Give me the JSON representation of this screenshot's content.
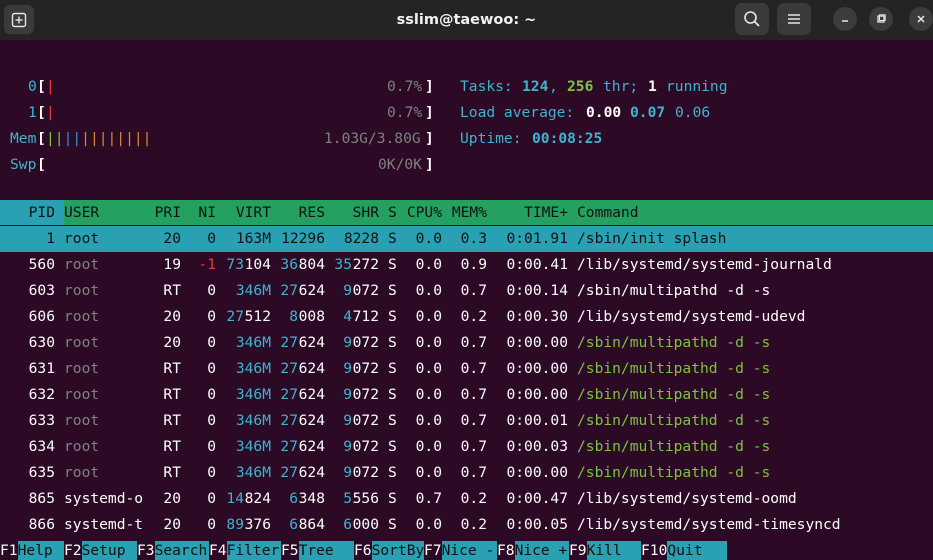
{
  "window": {
    "title": "sslim@taewoo: ~"
  },
  "icons": {
    "new_tab": "new-tab-icon",
    "search": "search-icon",
    "menu": "hamburger-menu-icon",
    "minimize": "minimize-icon",
    "maximize": "maximize-icon",
    "close": "close-icon"
  },
  "meters": {
    "cpu0": {
      "label": "0",
      "value": "0.7%",
      "fraction": 0.007
    },
    "cpu1": {
      "label": "1",
      "value": "0.7%",
      "fraction": 0.007
    },
    "mem": {
      "label": "Mem",
      "value": "1.03G/3.80G",
      "fraction": 0.27
    },
    "swp": {
      "label": "Swp",
      "value": "0K/0K",
      "fraction": 0.0
    }
  },
  "stats": {
    "tasks_label": "Tasks:",
    "tasks": "124",
    "threads": "256",
    "thr_label": "thr;",
    "running": "1",
    "running_label": "running",
    "load_label": "Load average:",
    "load1": "0.00",
    "load5": "0.07",
    "load15": "0.06",
    "uptime_label": "Uptime:",
    "uptime": "00:08:25"
  },
  "columns": [
    "PID",
    "USER",
    "PRI",
    "NI",
    "VIRT",
    "RES",
    "SHR",
    "S",
    "CPU%",
    "MEM%",
    "TIME+",
    "Command"
  ],
  "processes": [
    {
      "pid": "1",
      "user": "root",
      "pri": "20",
      "ni": "0",
      "virt": "163M",
      "res": "12296",
      "shr": "8228",
      "s": "S",
      "cpu": "0.0",
      "mem": "0.3",
      "time": "0:01.91",
      "cmd": "/sbin/init splash",
      "thread": false
    },
    {
      "pid": "560",
      "user": "root",
      "pri": "19",
      "ni": "-1",
      "virt": "73104",
      "res": "36804",
      "shr": "35272",
      "s": "S",
      "cpu": "0.0",
      "mem": "0.9",
      "time": "0:00.41",
      "cmd": "/lib/systemd/systemd-journald",
      "thread": false
    },
    {
      "pid": "603",
      "user": "root",
      "pri": "RT",
      "ni": "0",
      "virt": "346M",
      "res": "27624",
      "shr": "9072",
      "s": "S",
      "cpu": "0.0",
      "mem": "0.7",
      "time": "0:00.14",
      "cmd": "/sbin/multipathd -d -s",
      "thread": false
    },
    {
      "pid": "606",
      "user": "root",
      "pri": "20",
      "ni": "0",
      "virt": "27512",
      "res": "8008",
      "shr": "4712",
      "s": "S",
      "cpu": "0.0",
      "mem": "0.2",
      "time": "0:00.30",
      "cmd": "/lib/systemd/systemd-udevd",
      "thread": false
    },
    {
      "pid": "630",
      "user": "root",
      "pri": "20",
      "ni": "0",
      "virt": "346M",
      "res": "27624",
      "shr": "9072",
      "s": "S",
      "cpu": "0.0",
      "mem": "0.7",
      "time": "0:00.00",
      "cmd": "/sbin/multipathd -d -s",
      "thread": true
    },
    {
      "pid": "631",
      "user": "root",
      "pri": "RT",
      "ni": "0",
      "virt": "346M",
      "res": "27624",
      "shr": "9072",
      "s": "S",
      "cpu": "0.0",
      "mem": "0.7",
      "time": "0:00.00",
      "cmd": "/sbin/multipathd -d -s",
      "thread": true
    },
    {
      "pid": "632",
      "user": "root",
      "pri": "RT",
      "ni": "0",
      "virt": "346M",
      "res": "27624",
      "shr": "9072",
      "s": "S",
      "cpu": "0.0",
      "mem": "0.7",
      "time": "0:00.00",
      "cmd": "/sbin/multipathd -d -s",
      "thread": true
    },
    {
      "pid": "633",
      "user": "root",
      "pri": "RT",
      "ni": "0",
      "virt": "346M",
      "res": "27624",
      "shr": "9072",
      "s": "S",
      "cpu": "0.0",
      "mem": "0.7",
      "time": "0:00.01",
      "cmd": "/sbin/multipathd -d -s",
      "thread": true
    },
    {
      "pid": "634",
      "user": "root",
      "pri": "RT",
      "ni": "0",
      "virt": "346M",
      "res": "27624",
      "shr": "9072",
      "s": "S",
      "cpu": "0.0",
      "mem": "0.7",
      "time": "0:00.03",
      "cmd": "/sbin/multipathd -d -s",
      "thread": true
    },
    {
      "pid": "635",
      "user": "root",
      "pri": "RT",
      "ni": "0",
      "virt": "346M",
      "res": "27624",
      "shr": "9072",
      "s": "S",
      "cpu": "0.0",
      "mem": "0.7",
      "time": "0:00.00",
      "cmd": "/sbin/multipathd -d -s",
      "thread": true
    },
    {
      "pid": "865",
      "user": "systemd-o",
      "pri": "20",
      "ni": "0",
      "virt": "14824",
      "res": "6348",
      "shr": "5556",
      "s": "S",
      "cpu": "0.7",
      "mem": "0.2",
      "time": "0:00.47",
      "cmd": "/lib/systemd/systemd-oomd",
      "thread": false
    },
    {
      "pid": "866",
      "user": "systemd-t",
      "pri": "20",
      "ni": "0",
      "virt": "89376",
      "res": "6864",
      "shr": "6000",
      "s": "S",
      "cpu": "0.0",
      "mem": "0.2",
      "time": "0:00.05",
      "cmd": "/lib/systemd/systemd-timesyncd",
      "thread": false
    }
  ],
  "function_keys": [
    {
      "key": "F1",
      "label": "Help"
    },
    {
      "key": "F2",
      "label": "Setup"
    },
    {
      "key": "F3",
      "label": "Search"
    },
    {
      "key": "F4",
      "label": "Filter"
    },
    {
      "key": "F5",
      "label": "Tree"
    },
    {
      "key": "F6",
      "label": "SortBy"
    },
    {
      "key": "F7",
      "label": "Nice -"
    },
    {
      "key": "F8",
      "label": "Nice +"
    },
    {
      "key": "F9",
      "label": "Kill"
    },
    {
      "key": "F10",
      "label": "Quit"
    }
  ]
}
